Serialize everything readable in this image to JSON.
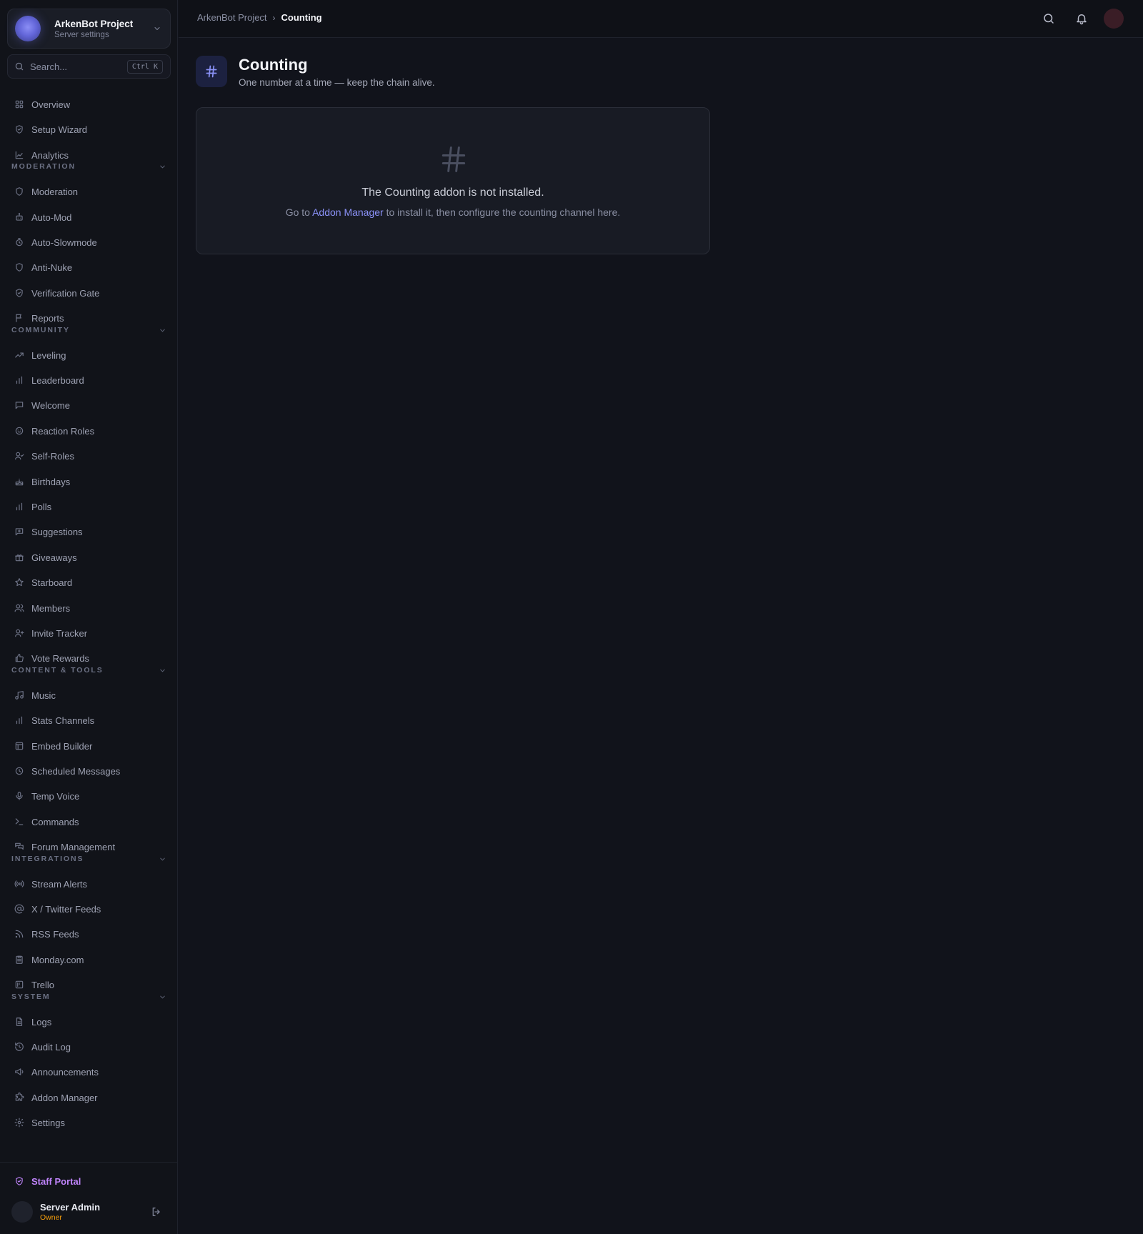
{
  "server": {
    "name": "ArkenBot Project",
    "subtitle": "Server settings"
  },
  "search": {
    "placeholder": "Search...",
    "shortcut": "Ctrl K"
  },
  "nav": {
    "top": [
      "Overview",
      "Setup Wizard",
      "Analytics"
    ],
    "moderation": {
      "title": "MODERATION",
      "items": [
        "Moderation",
        "Auto-Mod",
        "Auto-Slowmode",
        "Anti-Nuke",
        "Verification Gate",
        "Reports"
      ]
    },
    "community": {
      "title": "COMMUNITY",
      "items": [
        "Leveling",
        "Leaderboard",
        "Welcome",
        "Reaction Roles",
        "Self-Roles",
        "Birthdays",
        "Polls",
        "Suggestions",
        "Giveaways",
        "Starboard",
        "Members",
        "Invite Tracker",
        "Vote Rewards"
      ]
    },
    "content_tools": {
      "title": "CONTENT & TOOLS",
      "items": [
        "Music",
        "Stats Channels",
        "Embed Builder",
        "Scheduled Messages",
        "Temp Voice",
        "Commands",
        "Forum Management"
      ]
    },
    "integrations": {
      "title": "INTEGRATIONS",
      "items": [
        "Stream Alerts",
        "X / Twitter Feeds",
        "RSS Feeds",
        "Monday.com",
        "Trello"
      ]
    },
    "system": {
      "title": "SYSTEM",
      "items": [
        "Logs",
        "Audit Log",
        "Announcements",
        "Addon Manager",
        "Settings"
      ]
    }
  },
  "staff_portal": "Staff Portal",
  "user": {
    "name": "Server Admin",
    "role": "Owner"
  },
  "breadcrumb": {
    "parent": "ArkenBot Project",
    "separator": "›",
    "current": "Counting"
  },
  "page": {
    "title": "Counting",
    "subtitle": "One number at a time — keep the chain alive."
  },
  "empty_state": {
    "title": "The Counting addon is not installed.",
    "desc_prefix": "Go to ",
    "link": "Addon Manager",
    "desc_suffix": " to install it, then configure the counting channel here."
  },
  "icons": {
    "top": [
      "grid-icon",
      "shield-check-icon",
      "chart-line-icon"
    ],
    "moderation": [
      "shield-icon",
      "bot-icon",
      "timer-icon",
      "shield-icon",
      "shield-check-icon",
      "flag-icon"
    ],
    "community": [
      "trending-up-icon",
      "bar-chart-icon",
      "message-icon",
      "smile-icon",
      "user-check-icon",
      "cake-icon",
      "bar-chart-icon",
      "message-plus-icon",
      "gift-icon",
      "star-icon",
      "users-icon",
      "user-plus-icon",
      "thumbs-up-icon"
    ],
    "content_tools": [
      "music-icon",
      "bar-chart-icon",
      "layout-icon",
      "clock-icon",
      "mic-icon",
      "terminal-icon",
      "messages-icon"
    ],
    "integrations": [
      "radio-icon",
      "at-sign-icon",
      "rss-icon",
      "clipboard-icon",
      "trello-icon"
    ],
    "system": [
      "file-text-icon",
      "history-icon",
      "megaphone-icon",
      "puzzle-icon",
      "gear-icon"
    ]
  },
  "colors": {
    "accent": "#8b92f8",
    "staff": "#c084fc",
    "owner": "#f59e0b"
  }
}
